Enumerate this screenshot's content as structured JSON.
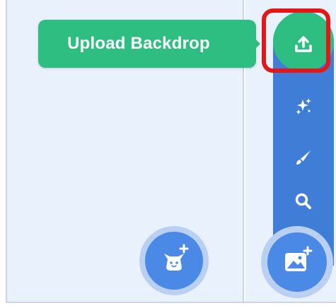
{
  "tooltip": {
    "text": "Upload Backdrop"
  },
  "menu": {
    "items": [
      {
        "name": "upload-backdrop",
        "icon": "upload-icon"
      },
      {
        "name": "surprise",
        "icon": "sparkle-icon"
      },
      {
        "name": "paint",
        "icon": "paintbrush-icon"
      },
      {
        "name": "choose-backdrop",
        "icon": "search-icon"
      }
    ]
  },
  "buttons": {
    "choose_sprite_icon": "cat-plus-icon",
    "choose_backdrop_icon": "image-plus-icon"
  },
  "colors": {
    "accent_green": "#2fbe81",
    "menu_blue": "#3f7dd6",
    "highlight_red": "#e31717",
    "pane_bg": "#e9f1fc"
  }
}
